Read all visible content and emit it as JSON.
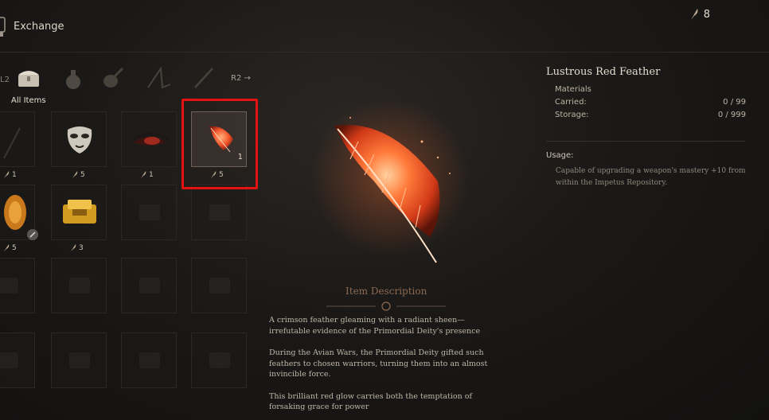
{
  "header": {
    "title": "Exchange",
    "currency_icon": "feather-icon",
    "currency_value": "8"
  },
  "tabs": {
    "left_hint": "L2",
    "right_hint": "R2 →",
    "selected_label": "All Items",
    "items": [
      {
        "icon": "chest-icon"
      },
      {
        "icon": "pouch-icon"
      },
      {
        "icon": "gourd-icon"
      },
      {
        "icon": "weapon-icon"
      },
      {
        "icon": "staff-icon"
      }
    ]
  },
  "grid": {
    "slots": [
      {
        "icon": "feather-icon",
        "qty": "1"
      },
      {
        "icon": "mask-icon",
        "qty": "5"
      },
      {
        "icon": "eye-icon",
        "qty": "1"
      },
      {
        "icon": "red-feather-icon",
        "qty": "5",
        "inner_qty": "1",
        "selected": true
      },
      {
        "icon": "amber-icon",
        "qty": "5"
      },
      {
        "icon": "gold-ingot-icon",
        "qty": "3"
      }
    ]
  },
  "description": {
    "heading": "Item Description",
    "paragraphs": [
      "A crimson feather gleaming with a radiant sheen—irrefutable evidence of the Primordial Deity's presence",
      "During the Avian Wars, the Primordial Deity gifted such feathers to chosen warriors, turning them into an almost invincible force.",
      "This brilliant red glow carries both the temptation of forsaking grace for power"
    ]
  },
  "details": {
    "name": "Lustrous Red Feather",
    "category": "Materials",
    "carried_label": "Carried:",
    "carried_value": "0 / 99",
    "storage_label": "Storage:",
    "storage_value": "0 / 999",
    "usage_label": "Usage:",
    "usage_text": "Capable of upgrading a weapon's mastery +10 from within the Impetus Repository."
  },
  "colors": {
    "highlight": "#e41212",
    "feather": "#ff5a2a",
    "background": "#1b1917"
  }
}
